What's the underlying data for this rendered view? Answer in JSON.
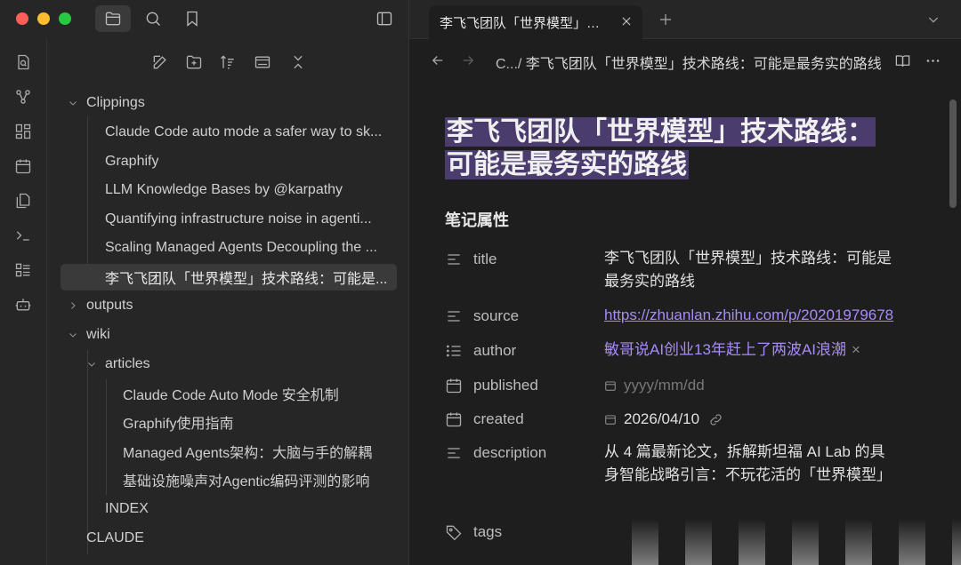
{
  "tab": {
    "title": "李飞飞团队「世界模型」技术路线：可能是最务实的路线"
  },
  "sidebar": {
    "tree": [
      {
        "label": "Clippings",
        "type": "folder",
        "expanded": true
      },
      {
        "label": "Claude Code auto mode a safer way to sk...",
        "type": "file"
      },
      {
        "label": "Graphify",
        "type": "file"
      },
      {
        "label": "LLM Knowledge Bases by @karpathy",
        "type": "file"
      },
      {
        "label": "Quantifying infrastructure noise in agenti...",
        "type": "file"
      },
      {
        "label": "Scaling Managed Agents Decoupling the ...",
        "type": "file"
      },
      {
        "label": "李飞飞团队「世界模型」技术路线：可能是...",
        "type": "file",
        "selected": true
      },
      {
        "label": "outputs",
        "type": "folder",
        "expanded": false
      },
      {
        "label": "wiki",
        "type": "folder",
        "expanded": true
      },
      {
        "label": "articles",
        "type": "folder",
        "expanded": true
      },
      {
        "label": "Claude Code Auto Mode 安全机制",
        "type": "file"
      },
      {
        "label": "Graphify使用指南",
        "type": "file"
      },
      {
        "label": "Managed Agents架构：大脑与手的解耦",
        "type": "file"
      },
      {
        "label": "基础设施噪声对Agentic编码评测的影响",
        "type": "file"
      },
      {
        "label": "INDEX",
        "type": "file"
      },
      {
        "label": "CLAUDE",
        "type": "file"
      }
    ]
  },
  "breadcrumb": {
    "folder": "C.../",
    "current": "李飞飞团队「世界模型」技术路线：可能是最务实的路线"
  },
  "doc": {
    "title_line1": "李飞飞团队「世界模型」技术路线：",
    "title_line2": "可能是最务实的路线",
    "props_heading": "笔记属性",
    "properties": {
      "title": {
        "key": "title",
        "value_line1": "李飞飞团队「世界模型」技术路线：可能是",
        "value_line2": "最务实的路线"
      },
      "source": {
        "key": "source",
        "value": "https://zhuanlan.zhihu.com/p/20201979678"
      },
      "author": {
        "key": "author",
        "value": "敏哥说AI创业13年赶上了两波AI浪潮",
        "remove": "×"
      },
      "published": {
        "key": "published",
        "placeholder": "yyyy/mm/dd"
      },
      "created": {
        "key": "created",
        "value": "2026/04/10"
      },
      "description": {
        "key": "description",
        "value_line1": "从 4 篇最新论文，拆解斯坦福 AI Lab 的具",
        "value_line2": "身智能战略引言：不玩花活的「世界模型」"
      },
      "tags": {
        "key": "tags"
      }
    }
  },
  "colors": {
    "accent": "#a78bfa",
    "title_highlight": "#4a3d6e",
    "selected_bg": "#3a3a3a"
  }
}
